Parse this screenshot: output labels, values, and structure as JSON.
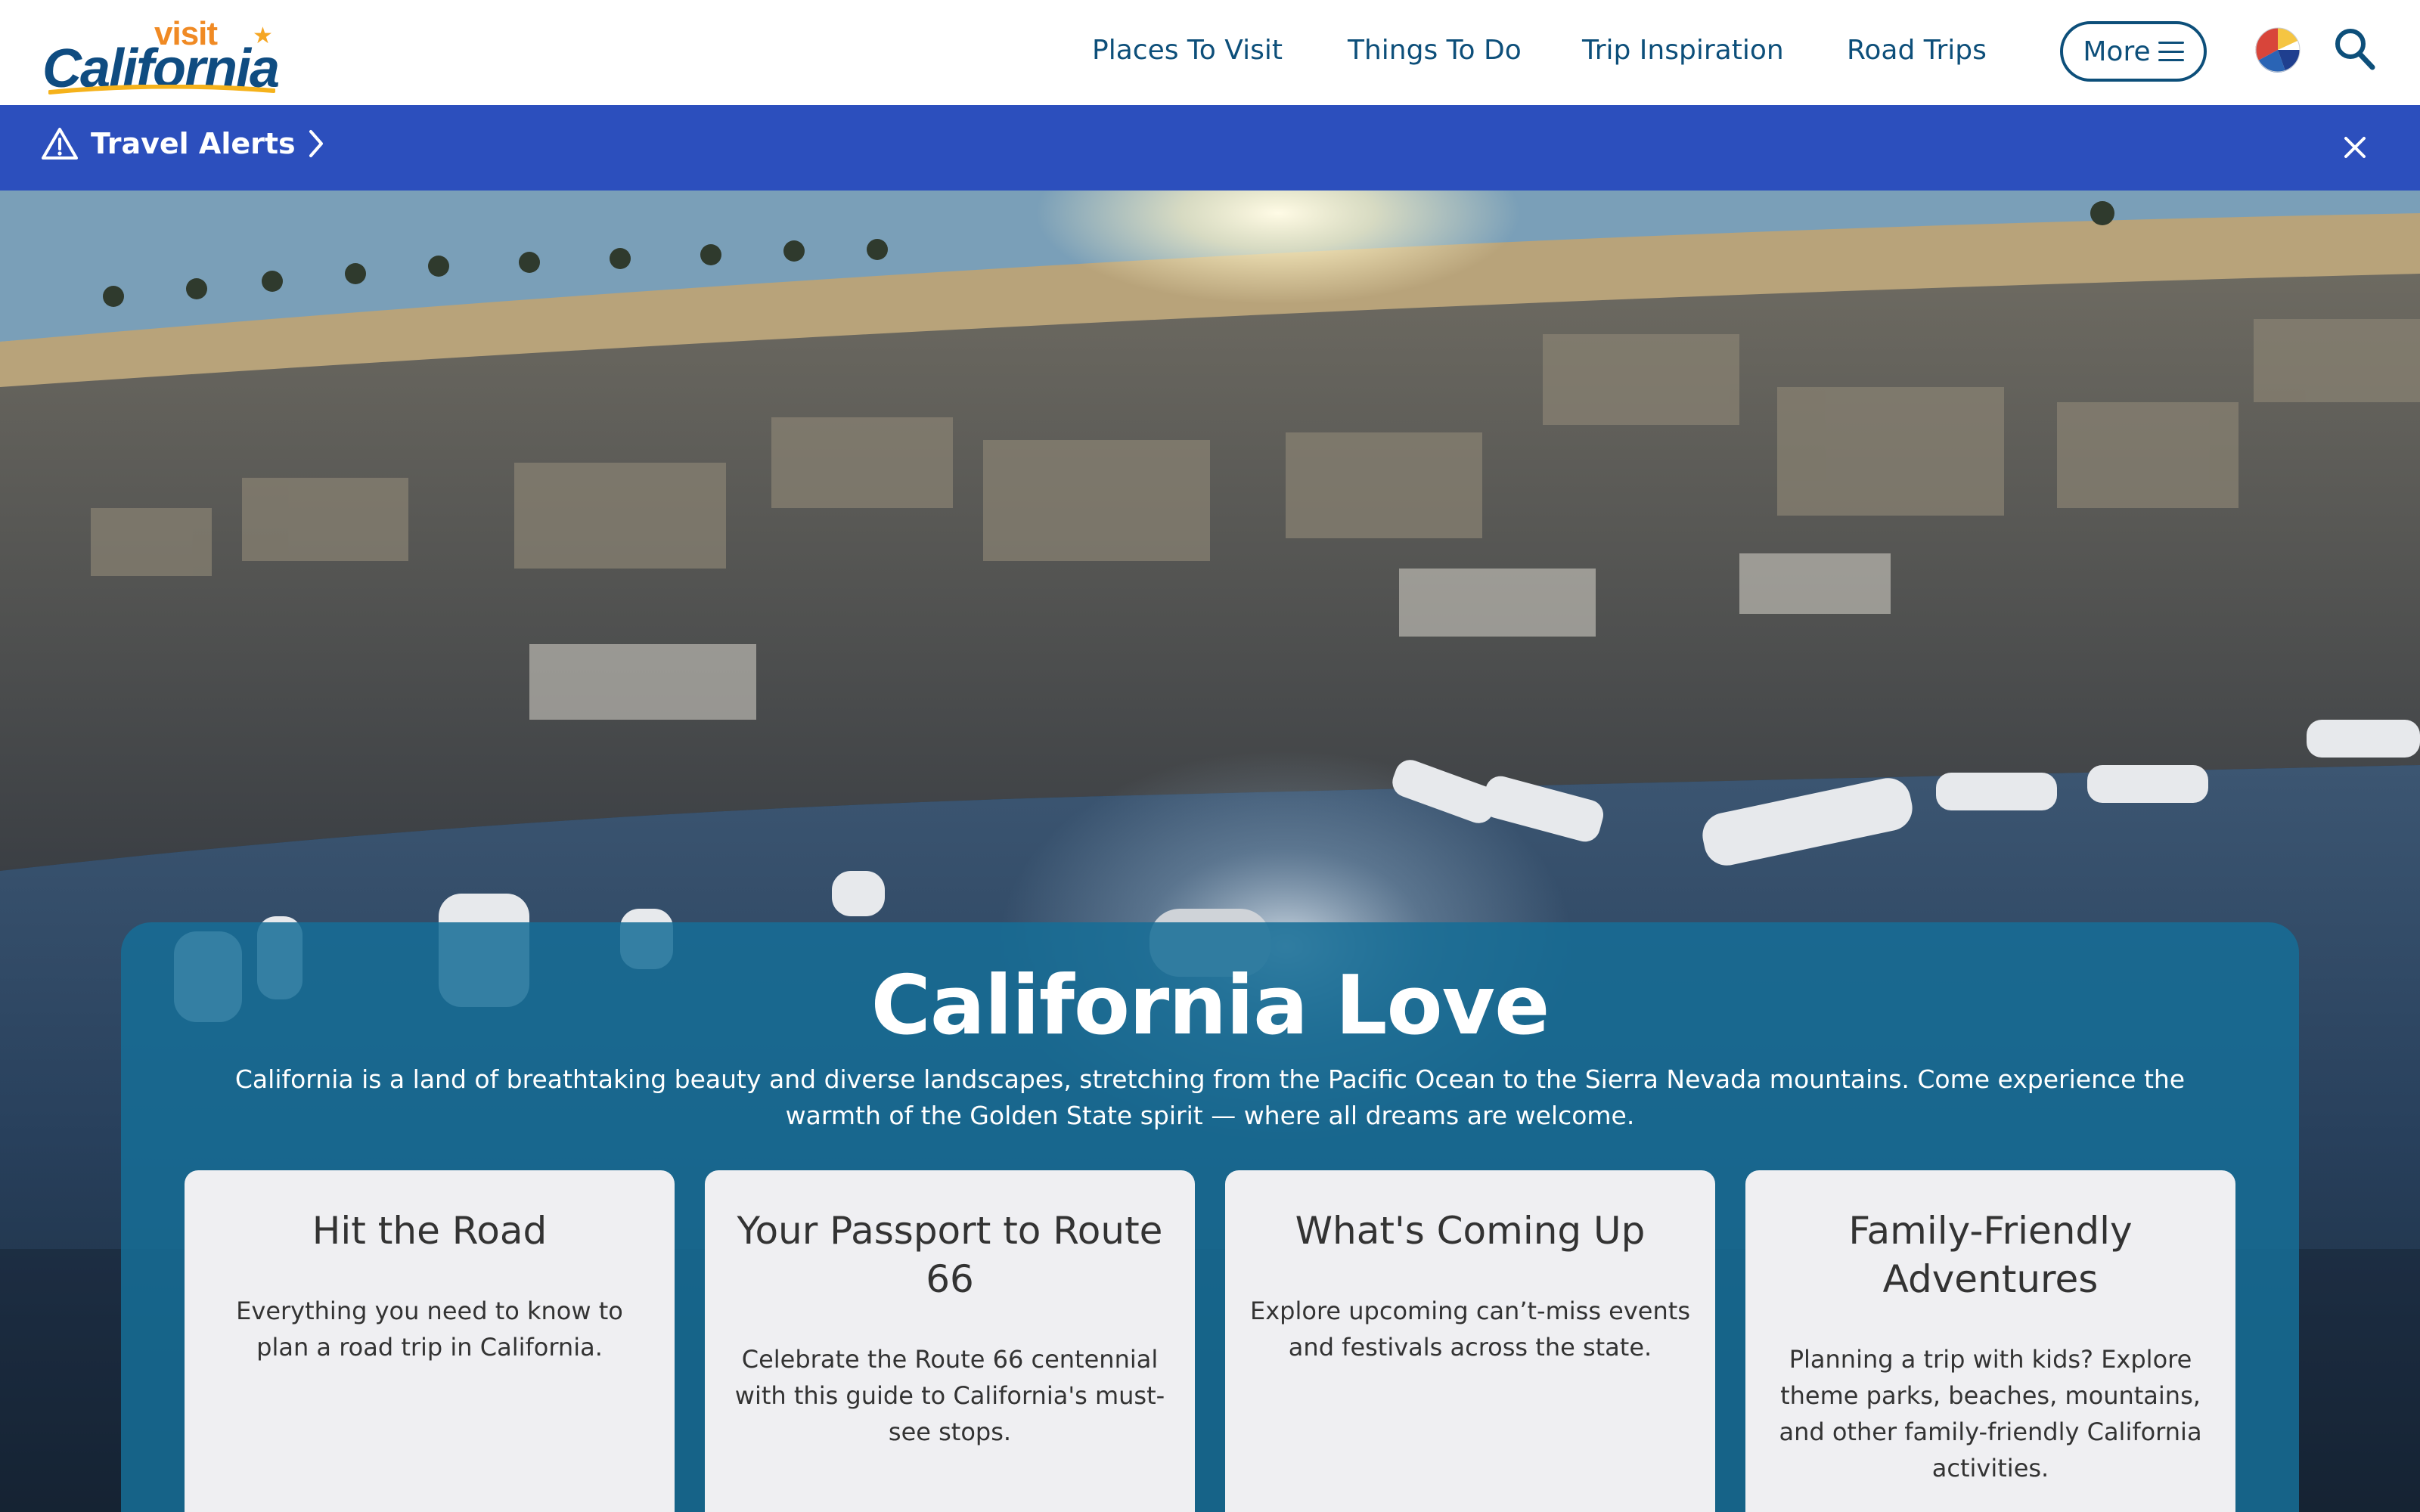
{
  "header": {
    "logo": {
      "visit": "visit",
      "california": "California",
      "trademark": "™"
    },
    "nav": [
      {
        "label": "Places To Visit"
      },
      {
        "label": "Things To Do"
      },
      {
        "label": "Trip Inspiration"
      },
      {
        "label": "Road Trips"
      }
    ],
    "more_label": "More",
    "icons": {
      "menu": "hamburger-icon",
      "language": "beach-ball-icon",
      "search": "search-icon"
    }
  },
  "alert": {
    "label": "Travel Alerts",
    "icons": {
      "warning": "warning-triangle-icon",
      "chevron": "chevron-right-icon",
      "close": "close-icon"
    }
  },
  "hero": {
    "title": "California Love",
    "description": "California is a land of breathtaking beauty and diverse landscapes, stretching from the Pacific Ocean to the Sierra Nevada mountains. Come experience the warmth of the Golden State spirit — where all dreams are welcome.",
    "cards": [
      {
        "title": "Hit the Road",
        "description": "Everything you need to know to plan a road trip in California."
      },
      {
        "title": "Your Passport to Route 66",
        "description": "Celebrate the Route 66 centennial with this guide to California's must-see stops."
      },
      {
        "title": "What's Coming Up",
        "description": "Explore upcoming can’t-miss events and festivals across the state."
      },
      {
        "title": "Family-Friendly Adventures",
        "description": "Planning a trip with kids? Explore theme parks, beaches, mountains, and other family-friendly California activities."
      }
    ]
  },
  "colors": {
    "brand_blue": "#0d4f7a",
    "brand_orange": "#f08a24",
    "alert_bar": "#2c4fbd",
    "panel": "#166e96",
    "card": "#efeff2"
  }
}
